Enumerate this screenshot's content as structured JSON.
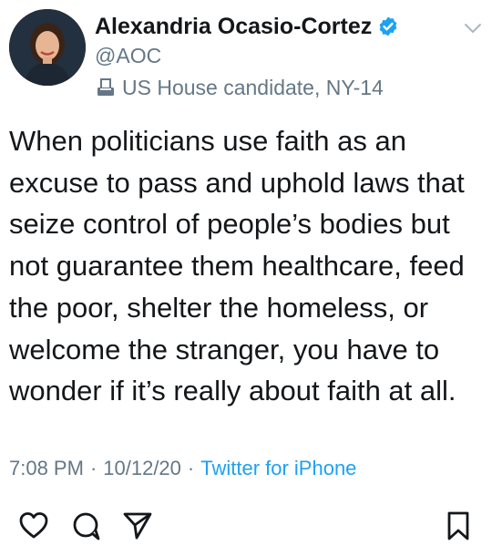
{
  "tweet": {
    "author_name": "Alexandria Ocasio-Cortez",
    "handle": "@AOC",
    "candidate_label": "US House candidate, NY-14",
    "text": "When politicians use faith as an\nexcuse to pass and uphold laws that\nseize control of people’s bodies but\nnot guarantee them healthcare, feed\nthe poor, shelter the homeless, or\nwelcome the stranger, you have to\nwonder if it’s really about faith at all.",
    "time": "7:08 PM",
    "date": "10/12/20",
    "separator": "·",
    "source": "Twitter for iPhone"
  },
  "icons": {
    "verified": "verified-badge-icon",
    "ballot": "ballot-box-icon",
    "menu": "chevron-down-icon",
    "like": "heart-icon",
    "reply": "comment-icon",
    "share": "share-icon",
    "bookmark": "bookmark-icon"
  },
  "colors": {
    "verified_blue": "#1da1f2",
    "secondary_text": "#657786",
    "primary_text": "#14171a",
    "link_blue": "#1da1f2"
  }
}
